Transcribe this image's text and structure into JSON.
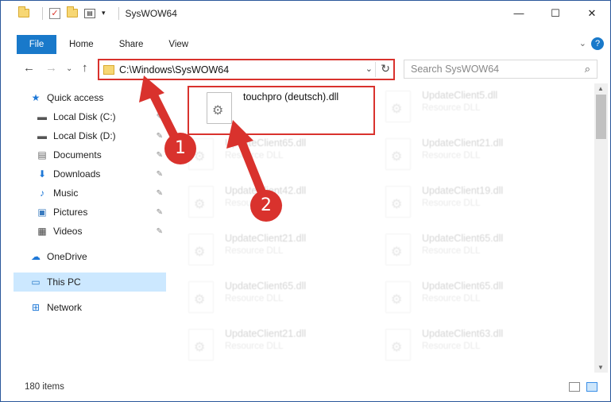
{
  "window": {
    "title": "SysWOW64",
    "controls": {
      "minimize": "—",
      "maximize": "☐",
      "close": "✕"
    }
  },
  "ribbon": {
    "tabs": [
      "File",
      "Home",
      "Share",
      "View"
    ],
    "expand": "⌄",
    "help": "?"
  },
  "navigation": {
    "back": "←",
    "forward": "→",
    "recent": "⌄",
    "up": "↑"
  },
  "address": {
    "path": "C:\\Windows\\SysWOW64",
    "dropdown": "⌄",
    "refresh": "↻"
  },
  "search": {
    "placeholder": "Search SysWOW64",
    "icon": "⌕"
  },
  "sidebar": {
    "items": [
      {
        "label": "Quick access",
        "icon": "★",
        "color": "#1e78d7"
      },
      {
        "label": "Local Disk (C:)",
        "icon": "▬",
        "color": "#555",
        "pinned": "📌"
      },
      {
        "label": "Local Disk (D:)",
        "icon": "▬",
        "color": "#555",
        "pinned": "📌"
      },
      {
        "label": "Documents",
        "icon": "▤",
        "color": "#666",
        "pinned": "📌"
      },
      {
        "label": "Downloads",
        "icon": "⬇",
        "color": "#1e78d7",
        "pinned": "📌"
      },
      {
        "label": "Music",
        "icon": "♪",
        "color": "#1e78d7",
        "pinned": "📌"
      },
      {
        "label": "Pictures",
        "icon": "▣",
        "color": "#3a7bbf",
        "pinned": "📌"
      },
      {
        "label": "Videos",
        "icon": "▦",
        "color": "#444",
        "pinned": "📌"
      },
      {
        "label": "OneDrive",
        "icon": "☁",
        "color": "#1e78d7"
      },
      {
        "label": "This PC",
        "icon": "▭",
        "color": "#2d7cc9"
      },
      {
        "label": "Network",
        "icon": "⊞",
        "color": "#1e78d7"
      }
    ]
  },
  "files": [
    {
      "name": "touchpro (deutsch).dll",
      "type": ""
    },
    {
      "name": "UpdateClient5.dll",
      "type": "Resource DLL"
    },
    {
      "name": "UpdateClient65.dll",
      "type": "Resource DLL"
    },
    {
      "name": "UpdateClient21.dll",
      "type": "Resource DLL"
    },
    {
      "name": "UpdateClient42.dll",
      "type": "Resource DLL"
    },
    {
      "name": "UpdateClient19.dll",
      "type": "Resource DLL"
    },
    {
      "name": "UpdateClient21.dll",
      "type": "Resource DLL"
    },
    {
      "name": "UpdateClient65.dll",
      "type": "Resource DLL"
    },
    {
      "name": "UpdateClient65.dll",
      "type": "Resource DLL"
    },
    {
      "name": "UpdateClient65.dll",
      "type": "Resource DLL"
    },
    {
      "name": "UpdateClient21.dll",
      "type": "Resource DLL"
    },
    {
      "name": "UpdateClient63.dll",
      "type": "Resource DLL"
    }
  ],
  "status": {
    "item_count": "180 items"
  },
  "annotations": {
    "marker1": "1",
    "marker2": "2",
    "color": "#d9322d"
  }
}
